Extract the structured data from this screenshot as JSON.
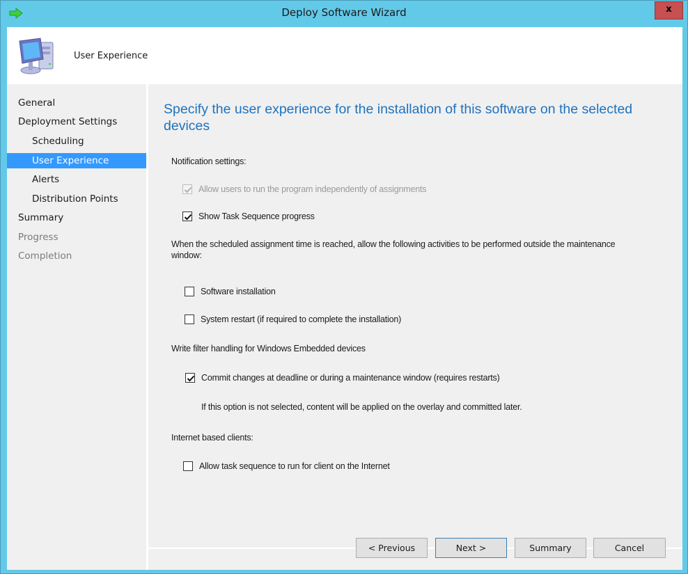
{
  "window": {
    "title": "Deploy Software Wizard",
    "close_label": "x",
    "colors": {
      "frame": "#63c9e9",
      "close": "#c75050",
      "accent_title": "#1e73be",
      "selection": "#3399ff"
    }
  },
  "header": {
    "title": "User Experience"
  },
  "sidebar": {
    "items": [
      {
        "label": "General",
        "level": 0,
        "state": "normal"
      },
      {
        "label": "Deployment Settings",
        "level": 0,
        "state": "normal"
      },
      {
        "label": "Scheduling",
        "level": 1,
        "state": "normal"
      },
      {
        "label": "User Experience",
        "level": 1,
        "state": "selected"
      },
      {
        "label": "Alerts",
        "level": 1,
        "state": "normal"
      },
      {
        "label": "Distribution Points",
        "level": 1,
        "state": "normal"
      },
      {
        "label": "Summary",
        "level": 0,
        "state": "normal"
      },
      {
        "label": "Progress",
        "level": 0,
        "state": "disabled"
      },
      {
        "label": "Completion",
        "level": 0,
        "state": "disabled"
      }
    ]
  },
  "main": {
    "title": "Specify the user experience for the installation of this software on the selected devices",
    "notification_label": "Notification settings:",
    "allow_independent": {
      "label": "Allow users to run the program independently of assignments",
      "checked": true,
      "disabled": true
    },
    "show_ts_progress": {
      "label": "Show Task Sequence progress",
      "checked": true
    },
    "maintenance_label": "When the scheduled assignment time is reached, allow the following activities to be performed outside the maintenance window:",
    "software_installation": {
      "label": "Software installation",
      "checked": false
    },
    "system_restart": {
      "label": "System restart (if required to complete the installation)",
      "checked": false
    },
    "write_filter_label": "Write filter handling for Windows Embedded devices",
    "commit_changes": {
      "label": "Commit changes at deadline or during a maintenance window (requires restarts)",
      "checked": true
    },
    "commit_note": "If this option is not selected, content will be applied on the overlay and committed later.",
    "internet_label": "Internet based clients:",
    "allow_internet": {
      "label": "Allow task sequence to run for client on the Internet",
      "checked": false
    }
  },
  "footer": {
    "previous": "< Previous",
    "next": "Next >",
    "summary": "Summary",
    "cancel": "Cancel"
  }
}
